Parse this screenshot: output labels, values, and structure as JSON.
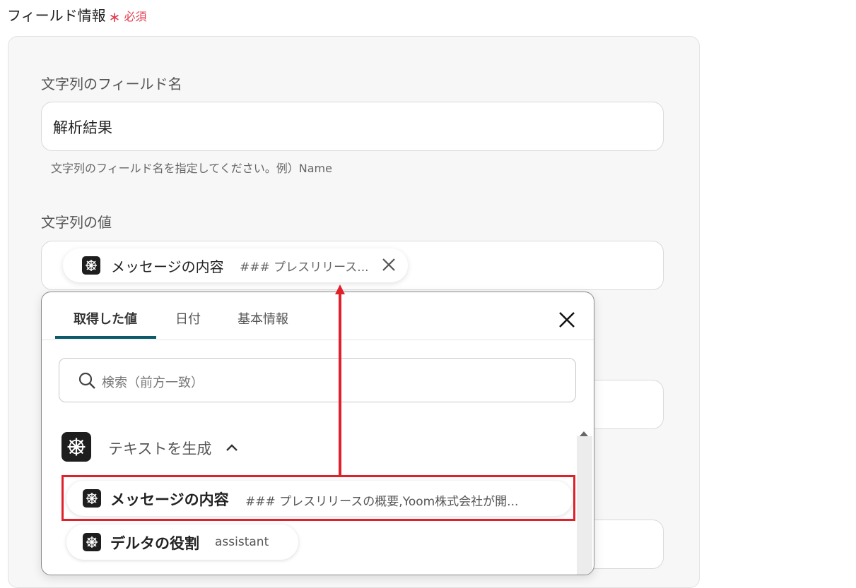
{
  "section": {
    "title": "フィールド情報",
    "required_mark": "∗",
    "required_label": "必須"
  },
  "field_name": {
    "label": "文字列のフィールド名",
    "value": "解析結果",
    "hint": "文字列のフィールド名を指定してください。例）Name"
  },
  "field_value": {
    "label": "文字列の値",
    "chip": {
      "label": "メッセージの内容",
      "preview": "### プレスリリース...",
      "icon": "app-icon"
    }
  },
  "picker": {
    "tabs": [
      {
        "label": "取得した値",
        "active": true
      },
      {
        "label": "日付",
        "active": false
      },
      {
        "label": "基本情報",
        "active": false
      }
    ],
    "search_placeholder": "検索（前方一致）",
    "group": {
      "label": "テキストを生成",
      "expanded": true
    },
    "items": [
      {
        "label": "メッセージの内容",
        "preview": "### プレスリリースの概要,Yoom株式会社が開...",
        "highlighted": true
      },
      {
        "label": "デルタの役割",
        "preview": "assistant",
        "highlighted": false
      }
    ]
  },
  "colors": {
    "required": "#e23d4f",
    "tab_underline": "#0d5a6a",
    "annotation": "#e0202a"
  }
}
